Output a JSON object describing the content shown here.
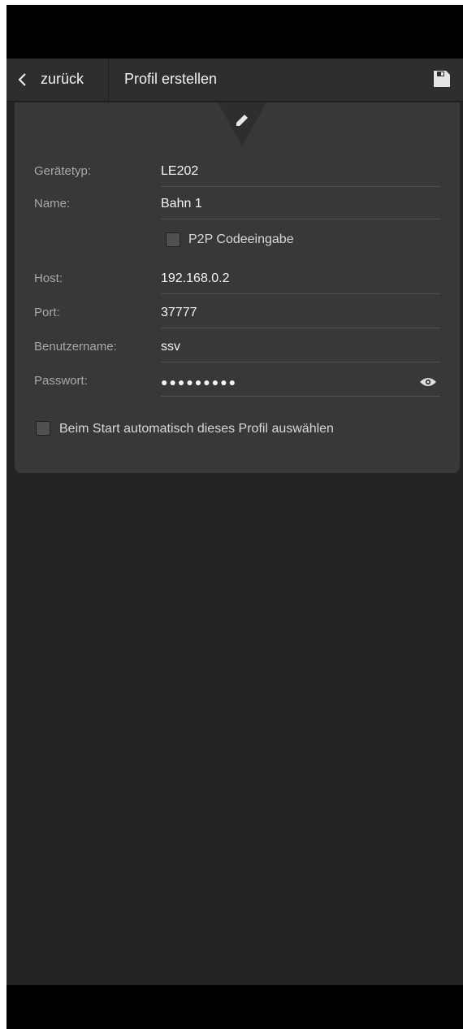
{
  "header": {
    "back_label": "zurück",
    "title": "Profil erstellen"
  },
  "form": {
    "device_type": {
      "label": "Gerätetyp:",
      "value": "LE202"
    },
    "name": {
      "label": "Name:",
      "value": "Bahn 1"
    },
    "p2p": {
      "label": "P2P Codeeingabe",
      "checked": false
    },
    "host": {
      "label": "Host:",
      "value": "192.168.0.2"
    },
    "port": {
      "label": "Port:",
      "value": "37777"
    },
    "username": {
      "label": "Benutzername:",
      "value": "ssv"
    },
    "password": {
      "label": "Passwort:",
      "value": "●●●●●●●●●"
    },
    "autostart": {
      "label": "Beim Start automatisch dieses Profil auswählen",
      "checked": false
    }
  },
  "icons": {
    "back": "chevron-left-icon",
    "save": "floppy-disk-icon",
    "edit": "pencil-icon",
    "reveal": "eye-icon"
  },
  "colors": {
    "background": "#232323",
    "header": "#2e2e2e",
    "card": "#383838",
    "text": "#f4f4f4",
    "label": "#a9a9a9"
  }
}
